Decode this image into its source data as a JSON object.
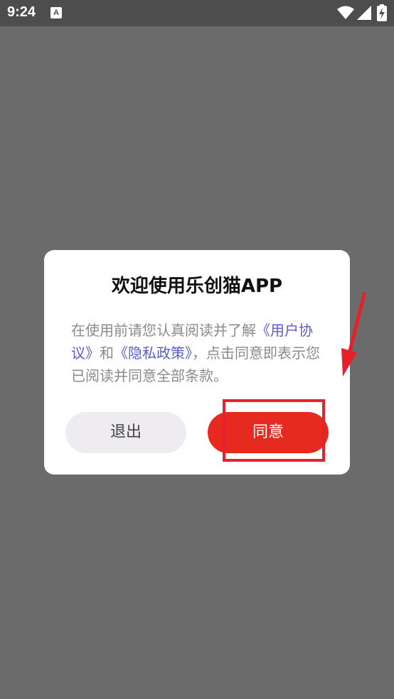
{
  "status_bar": {
    "time": "9:24",
    "notification_icon": "A"
  },
  "dialog": {
    "title": "欢迎使用乐创猫APP",
    "body_prefix": "在使用前请您认真阅读并了解",
    "user_agreement_link": "《用户协议》",
    "conjunction": "和",
    "privacy_policy_link": "《隐私政策》",
    "body_suffix": "，点击同意即表示您已阅读并同意全部条款。",
    "exit_label": "退出",
    "agree_label": "同意"
  },
  "colors": {
    "overlay_background": "#6b6b6b",
    "status_bar": "#4d4d4d",
    "link": "#5b5ccf",
    "agree_button": "#e62a1f",
    "exit_button": "#eeecf1",
    "annotation": "#e8202a"
  },
  "icons": {
    "wifi": "wifi-icon",
    "signal": "signal-icon",
    "battery": "battery-charging-icon",
    "annotation_arrow": "arrow-icon"
  }
}
